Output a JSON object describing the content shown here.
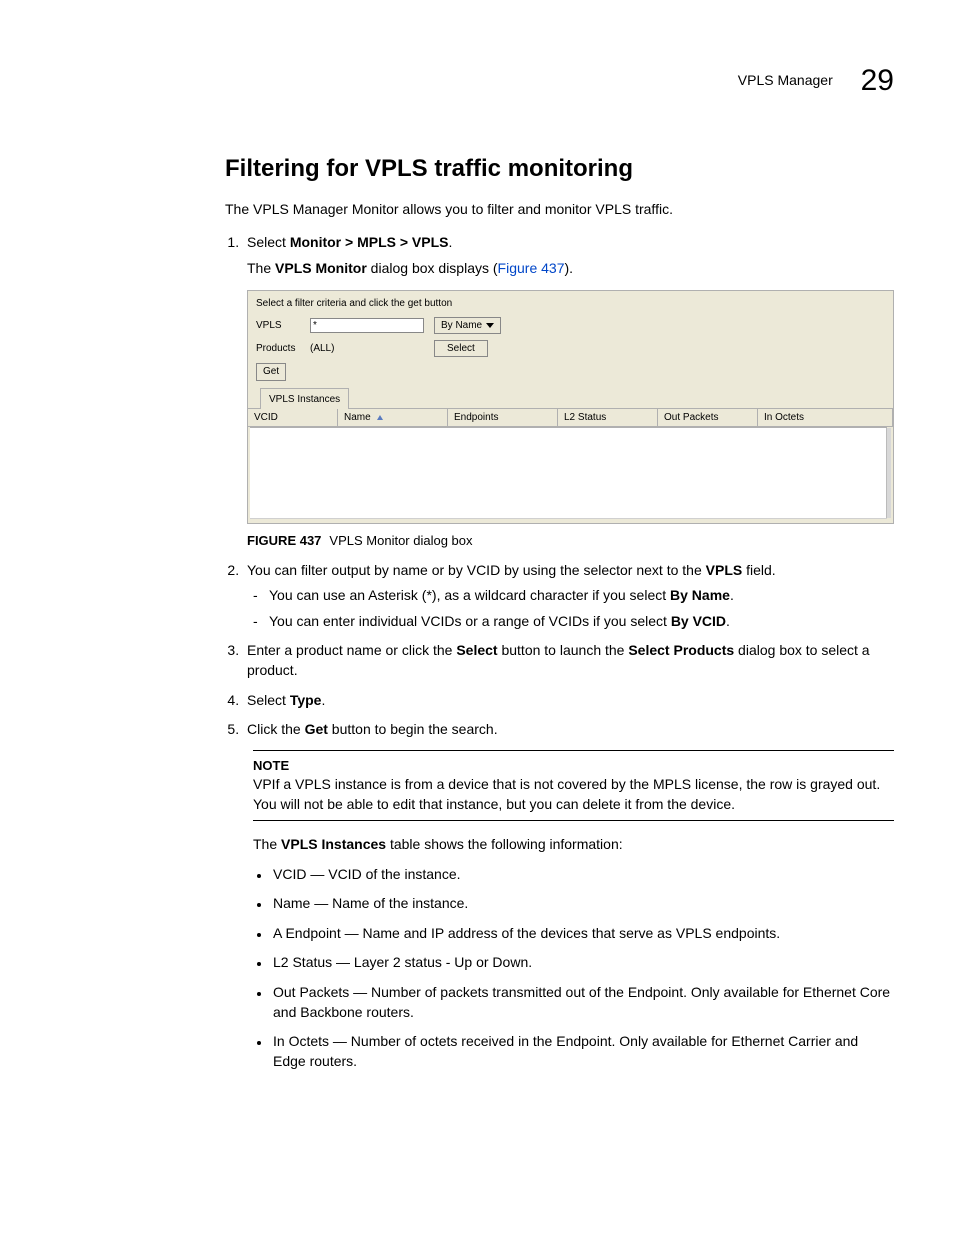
{
  "header": {
    "label": "VPLS Manager",
    "chapter": "29"
  },
  "title": "Filtering for VPLS traffic monitoring",
  "intro": "The VPLS Manager Monitor allows you to filter and monitor VPLS traffic.",
  "step1": {
    "lead": "Select ",
    "bold": "Monitor > MPLS > VPLS",
    "trail": ".",
    "sub_a": "The ",
    "sub_b": "VPLS Monitor",
    "sub_c": " dialog box displays (",
    "link": "Figure 437",
    "sub_d": ")."
  },
  "dialog": {
    "hint": "Select a filter criteria and click the get button",
    "vpls_label": "VPLS",
    "vpls_value": "*",
    "byname": "By Name",
    "products_label": "Products",
    "products_value": "(ALL)",
    "select_btn": "Select",
    "get_btn": "Get",
    "tab": "VPLS Instances",
    "cols": [
      "VCID",
      "Name",
      "Endpoints",
      "L2 Status",
      "Out Packets",
      "In Octets"
    ]
  },
  "figcap": {
    "num": "FIGURE 437",
    "text": "VPLS Monitor dialog box"
  },
  "step2": {
    "a": "You can filter output by name or by VCID by using the selector next to the ",
    "b": "VPLS",
    "c": " field.",
    "d1a": "You can use an Asterisk (*), as a wildcard character if you select ",
    "d1b": "By Name",
    "d1c": ".",
    "d2a": "You can enter individual VCIDs or a range of VCIDs if you select ",
    "d2b": "By VCID",
    "d2c": "."
  },
  "step3": {
    "a": "Enter a product name or click the ",
    "b": "Select",
    "c": " button to launch the ",
    "d": "Select Products",
    "e": " dialog box to select a product."
  },
  "step4": {
    "a": "Select ",
    "b": "Type",
    "c": "."
  },
  "step5": {
    "a": "Click the ",
    "b": "Get",
    "c": " button to begin the search."
  },
  "note": {
    "label": "NOTE",
    "body": "VPIf a VPLS instance is from a device that is not covered by the MPLS license, the row is grayed out. You will not be able to edit that instance, but you can delete it from the device."
  },
  "followup": {
    "a": "The ",
    "b": "VPLS Instances",
    "c": " table shows the following information:"
  },
  "bullets": [
    "VCID — VCID of the instance.",
    "Name — Name of the instance.",
    "A Endpoint — Name and IP address of the devices that serve as VPLS endpoints.",
    "L2 Status — Layer 2 status - Up or Down.",
    "Out Packets — Number of packets transmitted out of the Endpoint. Only available for Ethernet Core and Backbone routers.",
    "In Octets — Number of octets received in the Endpoint. Only available for Ethernet Carrier and Edge routers."
  ]
}
